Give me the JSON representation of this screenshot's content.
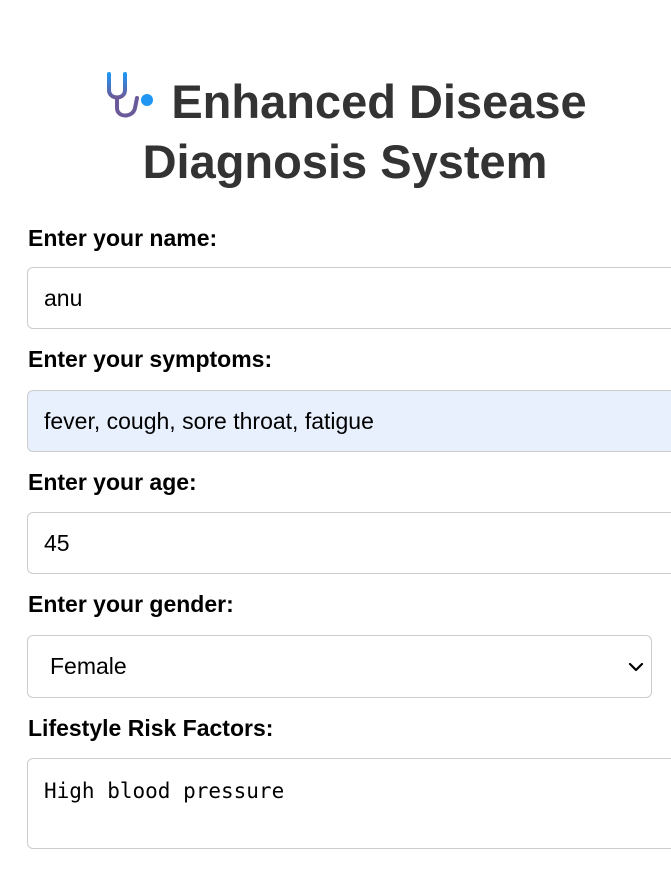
{
  "header": {
    "icon": "stethoscope-icon",
    "title": "Enhanced Disease Diagnosis System"
  },
  "form": {
    "name": {
      "label": "Enter your name:",
      "value": "anu"
    },
    "symptoms": {
      "label": "Enter your symptoms:",
      "value": "fever, cough, sore throat, fatigue"
    },
    "age": {
      "label": "Enter your age:",
      "value": "45"
    },
    "gender": {
      "label": "Enter your gender:",
      "selected": "Female",
      "icon": "chevron-down-icon"
    },
    "lifestyle": {
      "label": "Lifestyle Risk Factors:",
      "value": "High blood pressure"
    }
  },
  "colors": {
    "title_text": "#333333",
    "autofill_background": "#e8f0fe",
    "field_border": "#cccccc",
    "icon_blue": "#2196f3",
    "icon_purple": "#6a5a9a"
  }
}
